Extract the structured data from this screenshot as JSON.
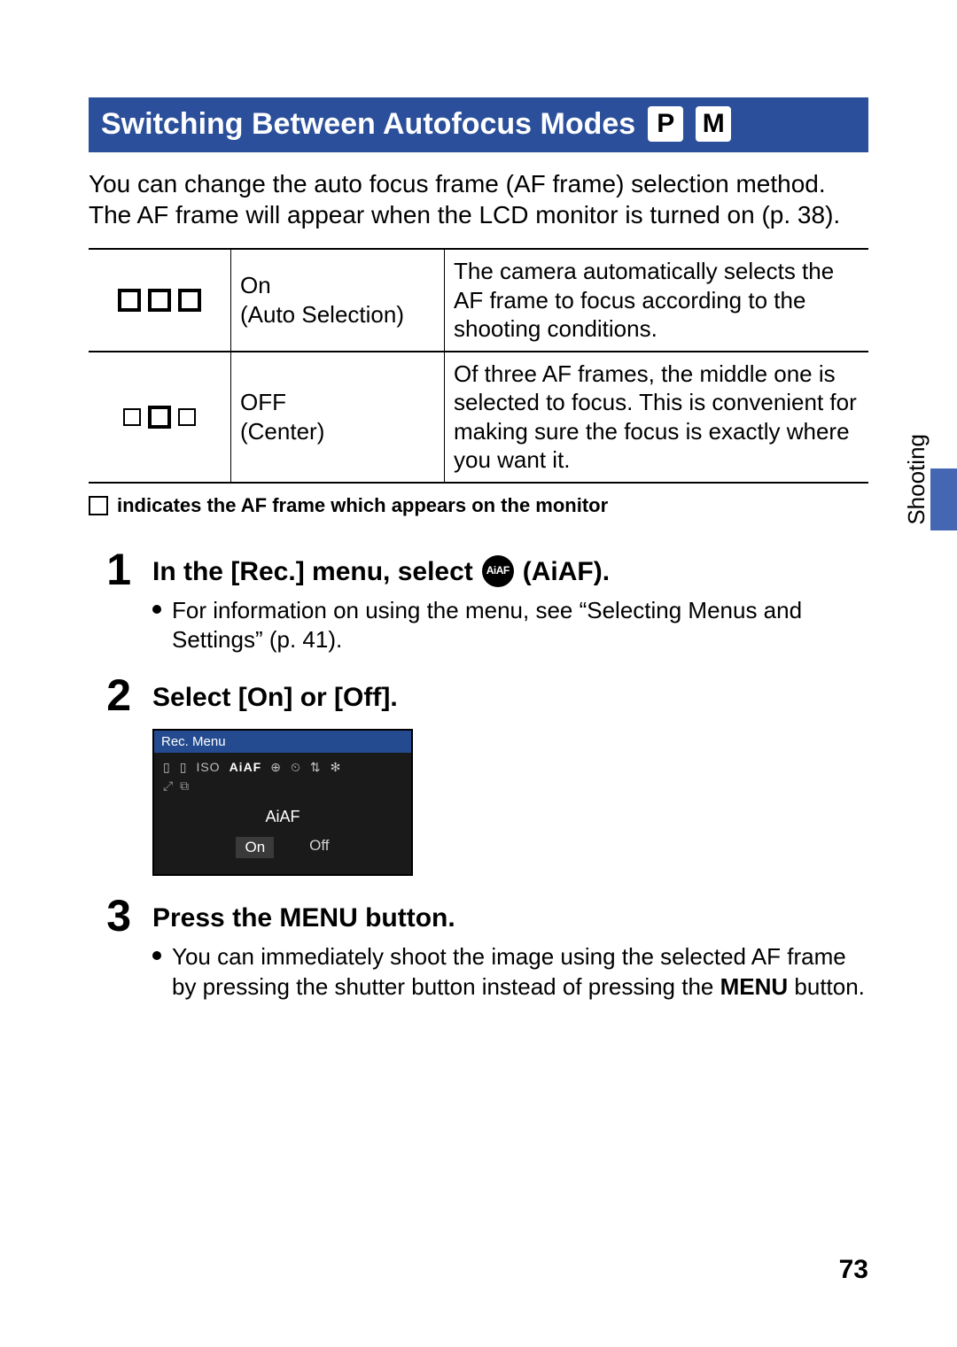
{
  "heading": "Switching Between Autofocus Modes",
  "mode_badges": [
    "P",
    "M"
  ],
  "intro": "You can change the auto focus frame (AF frame) selection method. The AF frame will appear when the LCD monitor is turned on (p. 38).",
  "table": {
    "rows": [
      {
        "setting_line1": "On",
        "setting_line2": "(Auto Selection)",
        "desc": "The camera automatically selects the AF frame to focus according to the shooting conditions."
      },
      {
        "setting_line1": "OFF",
        "setting_line2": "(Center)",
        "desc": "Of three AF frames, the middle one is selected to focus. This is convenient for making sure the focus is exactly where you want it."
      }
    ],
    "note": "indicates the AF frame which appears on the monitor"
  },
  "steps": [
    {
      "num": "1",
      "title_pre": "In the [Rec.] menu, select",
      "title_icon": "AiAF",
      "title_post": "(AiAF).",
      "bullets": [
        "For information on using the menu, see “Selecting Menus and Settings” (p. 41)."
      ]
    },
    {
      "num": "2",
      "title_pre": "Select [On] or [Off].",
      "lcd": {
        "title": "Rec. Menu",
        "row_label": "AiAF",
        "opt_on": "On",
        "opt_off": "Off"
      }
    },
    {
      "num": "3",
      "title_pre": "Press the MENU button.",
      "bullets": [
        "You can immediately shoot the image using the selected AF frame by pressing the shutter button instead of pressing the MENU button."
      ],
      "bullet_menu_word": "MENU"
    }
  ],
  "side_tab": "Shooting",
  "page_number": "73"
}
